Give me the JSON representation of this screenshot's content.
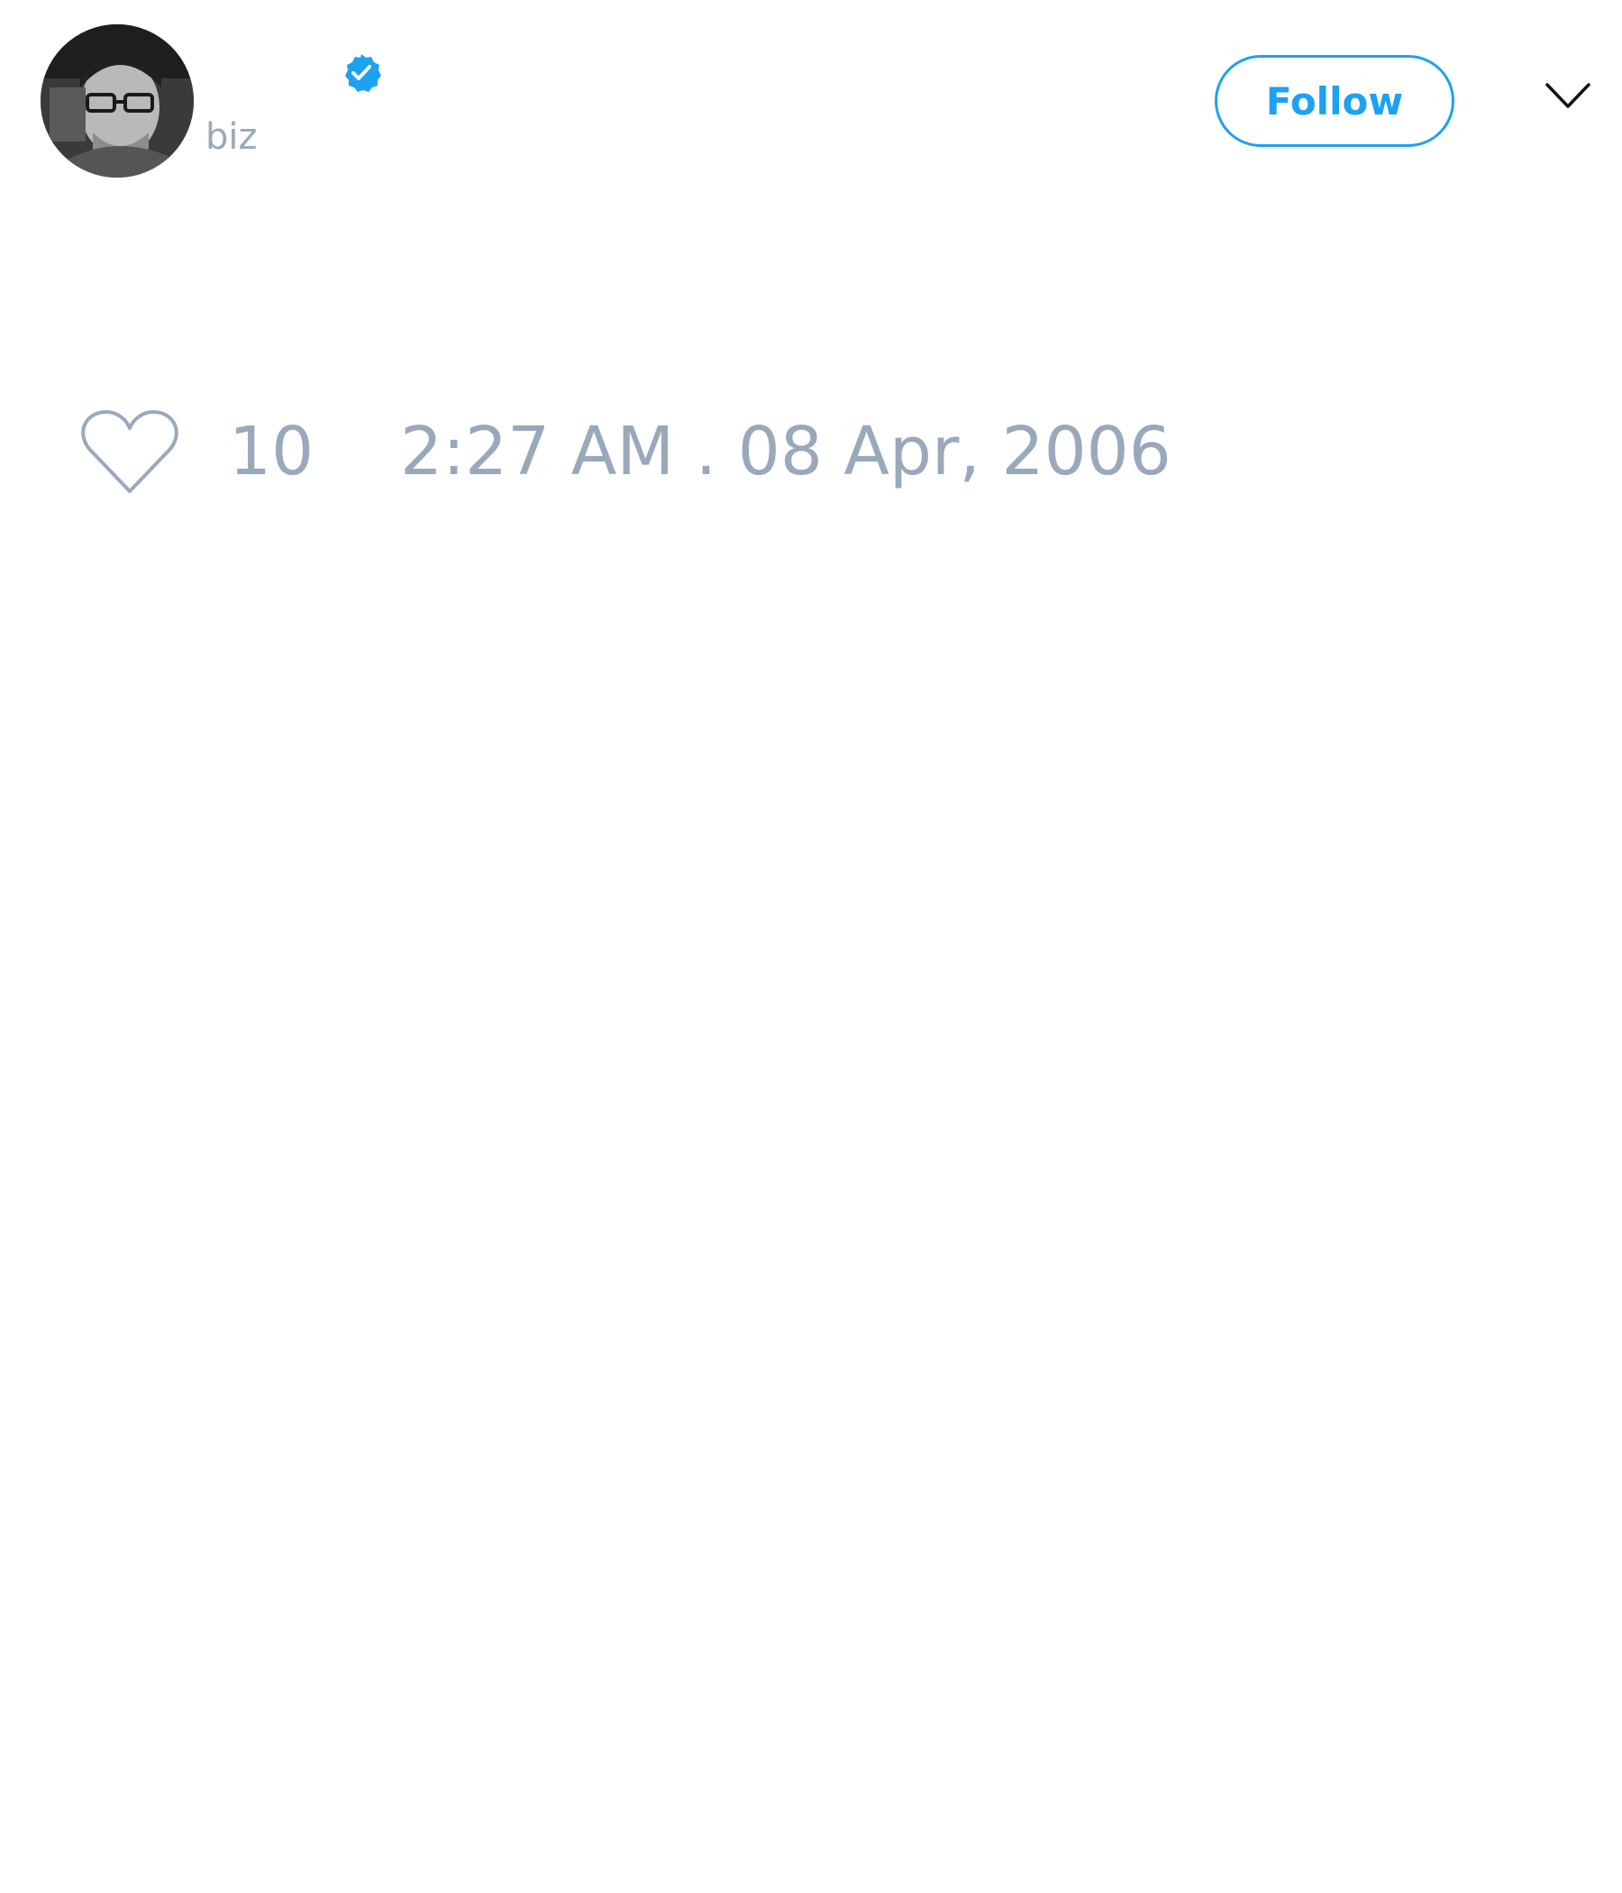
{
  "header": {
    "avatar_icon": "user-avatar-photo",
    "verified_icon": "verified-badge-icon",
    "handle": "biz",
    "follow_label": "Follow",
    "menu_icon": "chevron-down-icon"
  },
  "actions": {
    "like_icon": "heart-outline-icon",
    "like_count": "10",
    "timestamp": "2:27 AM . 08 Apr, 2006"
  },
  "colors": {
    "accent": "#1da1f2",
    "muted_text": "#99a9bb",
    "background": "#ffffff"
  }
}
